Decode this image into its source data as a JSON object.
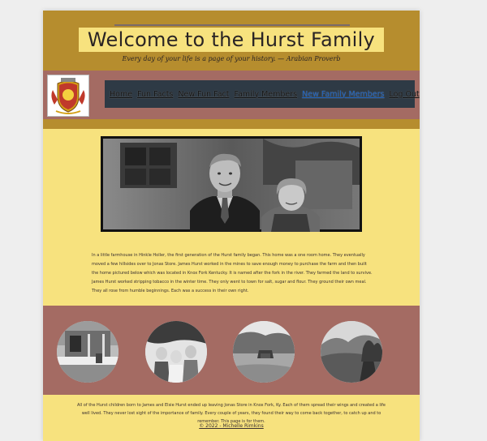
{
  "header": {
    "title": "Welcome to the Hurst Family",
    "tagline": "Every day of your life is a page of your history. — Arabian Proverb"
  },
  "nav": {
    "items": [
      {
        "label": "Home",
        "active": false
      },
      {
        "label": "Fun Facts",
        "active": false
      },
      {
        "label": "New Fun Fact",
        "active": false
      },
      {
        "label": "Family Members",
        "active": false
      },
      {
        "label": "New Family Members",
        "active": true
      },
      {
        "label": "Log Out",
        "active": false
      }
    ]
  },
  "main": {
    "intro": "In a little farmhouse in Hinkle Holler, the first generation of the Hurst family began. This home was a one room home. They eventually moved a few hillsides over to Jonas Store. James Hurst worked in the mines to save enough money to purchase the farm and then built the home pictured below which was located in Knox Fork Kentucky. It is named after the fork in the river. They farmed the land to survive. James Hurst worked stripping tobacco in the winter time. They only went to town for salt, sugar and flour. They ground their own meal. They all rose from humble beginnings. Each was a success in their own right."
  },
  "footer": {
    "text": "All of the Hurst children born to James and Elsie Hurst ended up leaving Jonas Store in Knox Fork, Ky. Each of them spread their wings and created a life well lived. They never lost sight of the importance of family. Every couple of years, they found their way to come back together, to catch up and to remember. This page is for them.",
    "copyright": "© 2022 - Michelle Rimkins"
  },
  "colors": {
    "gold": "#b68d2e",
    "cream": "#f7e27e",
    "rose": "#a46b63",
    "nav_bg": "#2e3a45",
    "active_link": "#1d63c0"
  }
}
